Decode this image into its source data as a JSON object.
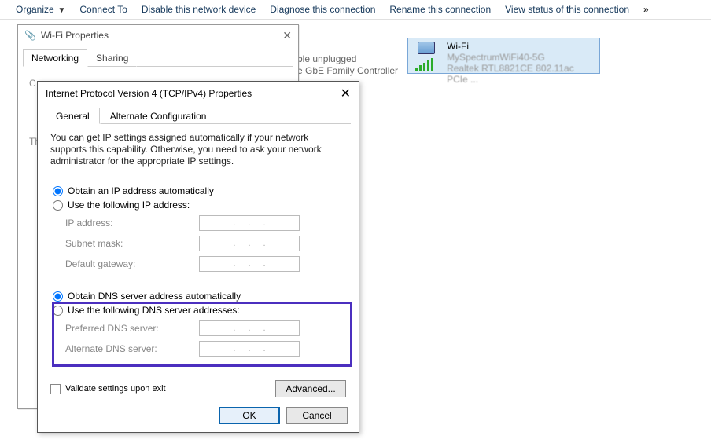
{
  "toolbar": {
    "organize": "Organize",
    "connect": "Connect To",
    "disable": "Disable this network device",
    "diagnose": "Diagnose this connection",
    "rename": "Rename this connection",
    "viewstatus": "View status of this connection",
    "more": "»"
  },
  "adapter": {
    "name": "Wi-Fi",
    "ssid": "MySpectrumWiFi40-5G",
    "driver": "Realtek RTL8821CE 802.11ac PCIe ..."
  },
  "under": {
    "line1": "ble unplugged",
    "line2": "e GbE Family Controller"
  },
  "wifiprop": {
    "title": "Wi-Fi Properties",
    "tabs": {
      "networking": "Networking",
      "sharing": "Sharing"
    },
    "connect_label": "C",
    "this_label": "Thi"
  },
  "ipv4": {
    "title": "Internet Protocol Version 4 (TCP/IPv4) Properties",
    "tabs": {
      "general": "General",
      "alt": "Alternate Configuration"
    },
    "desc": "You can get IP settings assigned automatically if your network supports this capability. Otherwise, you need to ask your network administrator for the appropriate IP settings.",
    "ip_auto": "Obtain an IP address automatically",
    "ip_manual": "Use the following IP address:",
    "ip_address": "IP address:",
    "subnet": "Subnet mask:",
    "gateway": "Default gateway:",
    "dns_auto": "Obtain DNS server address automatically",
    "dns_manual": "Use the following DNS server addresses:",
    "pref_dns": "Preferred DNS server:",
    "alt_dns": "Alternate DNS server:",
    "validate": "Validate settings upon exit",
    "advanced": "Advanced...",
    "ok": "OK",
    "cancel": "Cancel"
  }
}
